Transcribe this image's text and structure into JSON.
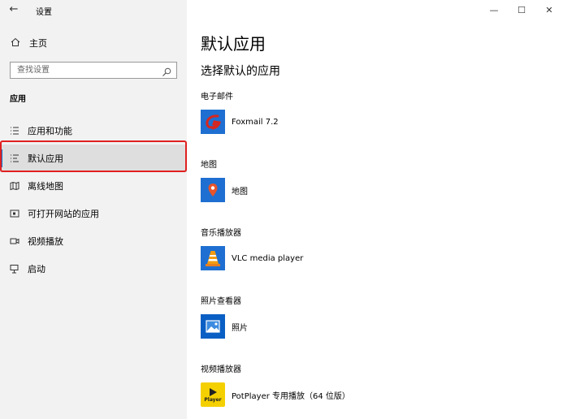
{
  "window": {
    "title": "设置",
    "back_icon": "arrow-left-icon",
    "controls": {
      "minimize": "—",
      "maximize": "☐",
      "close": "✕"
    }
  },
  "sidebar": {
    "home_label": "主页",
    "search_placeholder": "查找设置",
    "section_title": "应用",
    "items": [
      {
        "label": "应用和功能",
        "icon": "list-icon",
        "selected": false
      },
      {
        "label": "默认应用",
        "icon": "list-check-icon",
        "selected": true
      },
      {
        "label": "离线地图",
        "icon": "map-icon",
        "selected": false
      },
      {
        "label": "可打开网站的应用",
        "icon": "website-icon",
        "selected": false
      },
      {
        "label": "视频播放",
        "icon": "video-icon",
        "selected": false
      },
      {
        "label": "启动",
        "icon": "startup-icon",
        "selected": false
      }
    ]
  },
  "main": {
    "title": "默认应用",
    "subtitle": "选择默认的应用",
    "categories": [
      {
        "name": "电子邮件",
        "app": "Foxmail 7.2",
        "icon": "foxmail-icon"
      },
      {
        "name": "地图",
        "app": "地图",
        "icon": "maps-app-icon"
      },
      {
        "name": "音乐播放器",
        "app": "VLC media player",
        "icon": "vlc-icon"
      },
      {
        "name": "照片查看器",
        "app": "照片",
        "icon": "photos-app-icon"
      },
      {
        "name": "视频播放器",
        "app": "PotPlayer 专用播放（64 位版）",
        "icon": "potplayer-icon"
      }
    ],
    "potplayer_tile_text": "Player"
  },
  "colors": {
    "accent": "#0078d7",
    "selection_outline": "#e02020",
    "sidebar_bg": "#f2f2f2"
  }
}
